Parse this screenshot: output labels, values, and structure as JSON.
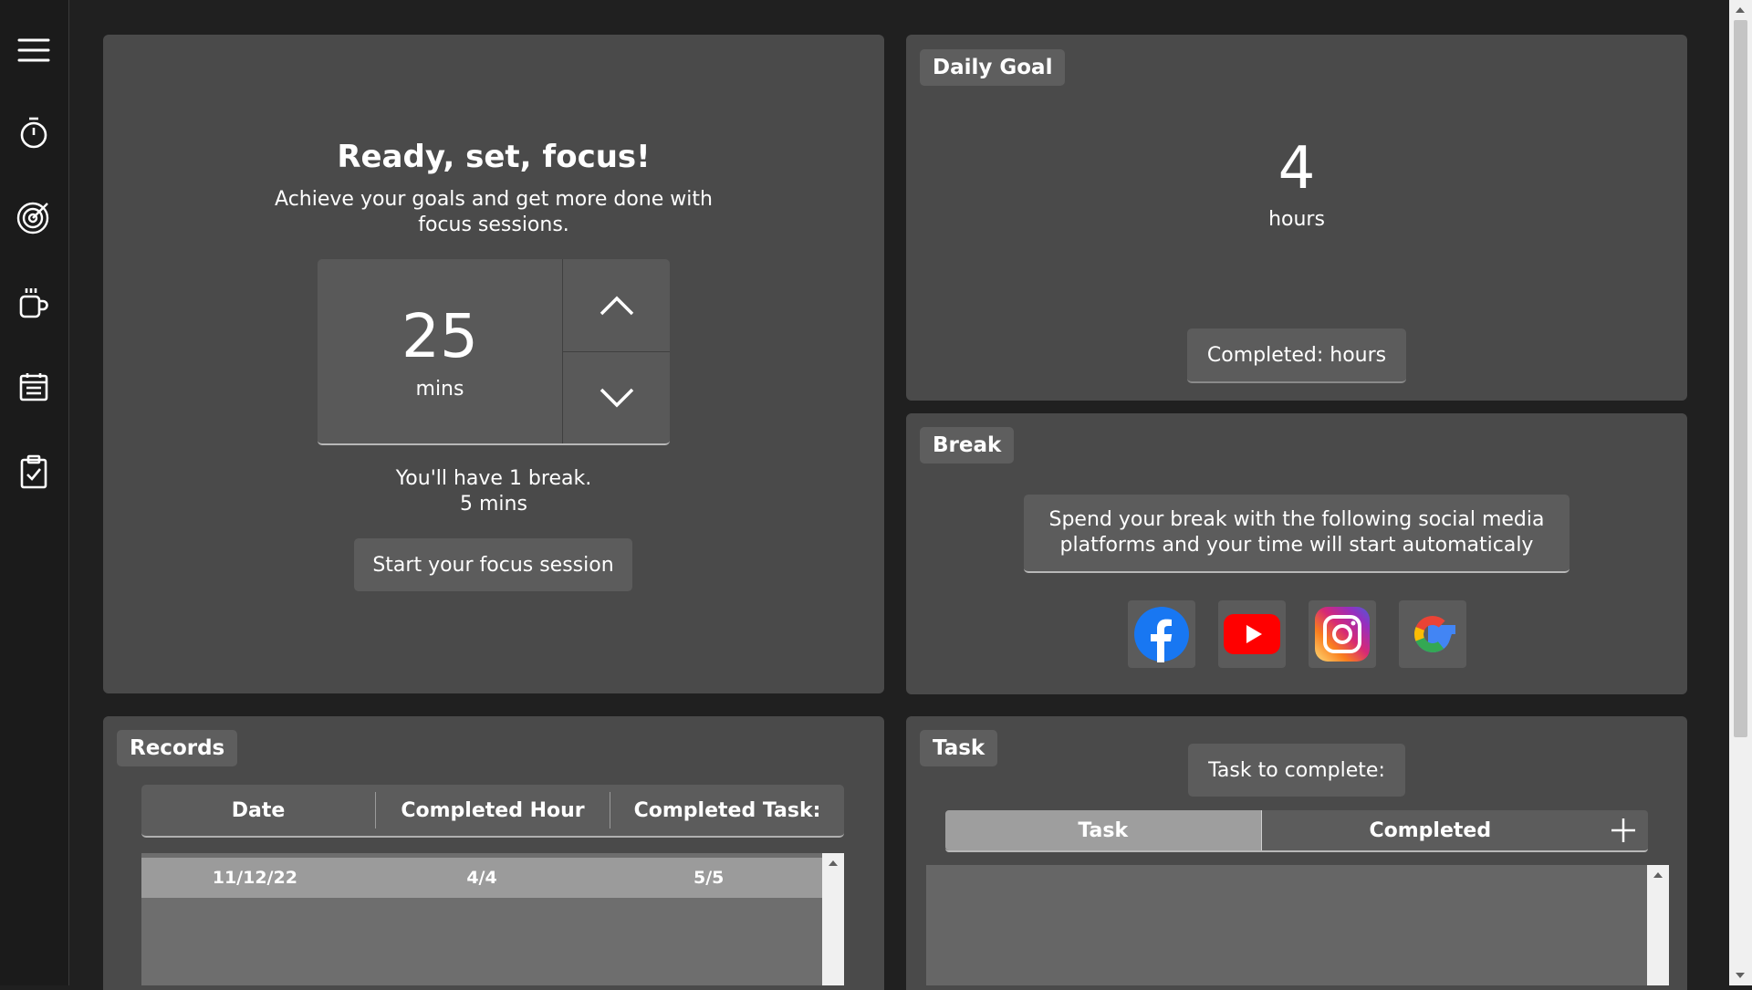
{
  "focus": {
    "title": "Ready, set, focus!",
    "subtitle_line1": "Achieve your goals and get more done with",
    "subtitle_line2": "focus sessions.",
    "minutes_value": "25",
    "minutes_unit": "mins",
    "break_line1": "You'll have 1 break.",
    "break_line2": "5 mins",
    "start_button": "Start your focus session"
  },
  "daily_goal": {
    "tag": "Daily Goal",
    "value": "4",
    "unit": "hours",
    "completed_button": "Completed: hours"
  },
  "break_panel": {
    "tag": "Break",
    "message_line1": "Spend your break with the following social media",
    "message_line2": "platforms and your time will start automaticaly",
    "platforms": [
      "facebook-icon",
      "youtube-icon",
      "instagram-icon",
      "google-icon"
    ]
  },
  "records": {
    "tag": "Records",
    "columns": [
      "Date",
      "Completed Hour",
      "Completed Task:"
    ],
    "rows": [
      {
        "date": "11/12/22",
        "hours": "4/4",
        "tasks": "5/5"
      }
    ]
  },
  "task": {
    "tag": "Task",
    "to_complete_button": "Task to complete:",
    "tabs": [
      "Task",
      "Completed"
    ],
    "add_icon": "plus-icon"
  },
  "colors": {
    "background": "#202020",
    "panel": "#4a4a4a",
    "sidebar": "#1b1b1b",
    "accent_gray": "#5c5c5c"
  }
}
